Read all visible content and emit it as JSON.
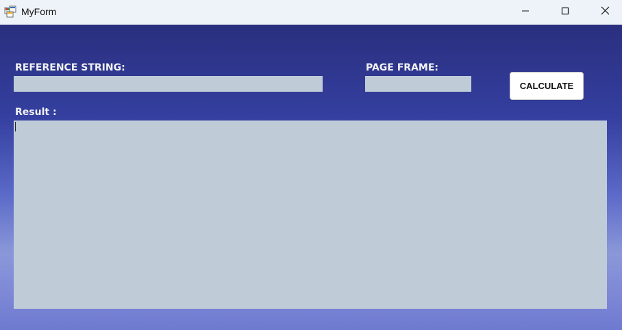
{
  "window": {
    "title": "MyForm",
    "icon": "form-app-icon",
    "controls": {
      "minimize_icon": "minimize-icon",
      "maximize_icon": "maximize-icon",
      "close_icon": "close-icon"
    }
  },
  "form": {
    "reference_string_label": "REFERENCE STRING:",
    "reference_string_value": "",
    "page_frame_label": "PAGE FRAME:",
    "page_frame_value": "",
    "calculate_button_label": "CALCULATE",
    "result_label": "Result :",
    "result_value": ""
  },
  "colors": {
    "titlebar": "#eef3f9",
    "textbox": "#bfccd8",
    "label_text": "#f2f2f2",
    "gradient_top": "#2a2f7e",
    "gradient_bottom": "#6e7ad0"
  }
}
